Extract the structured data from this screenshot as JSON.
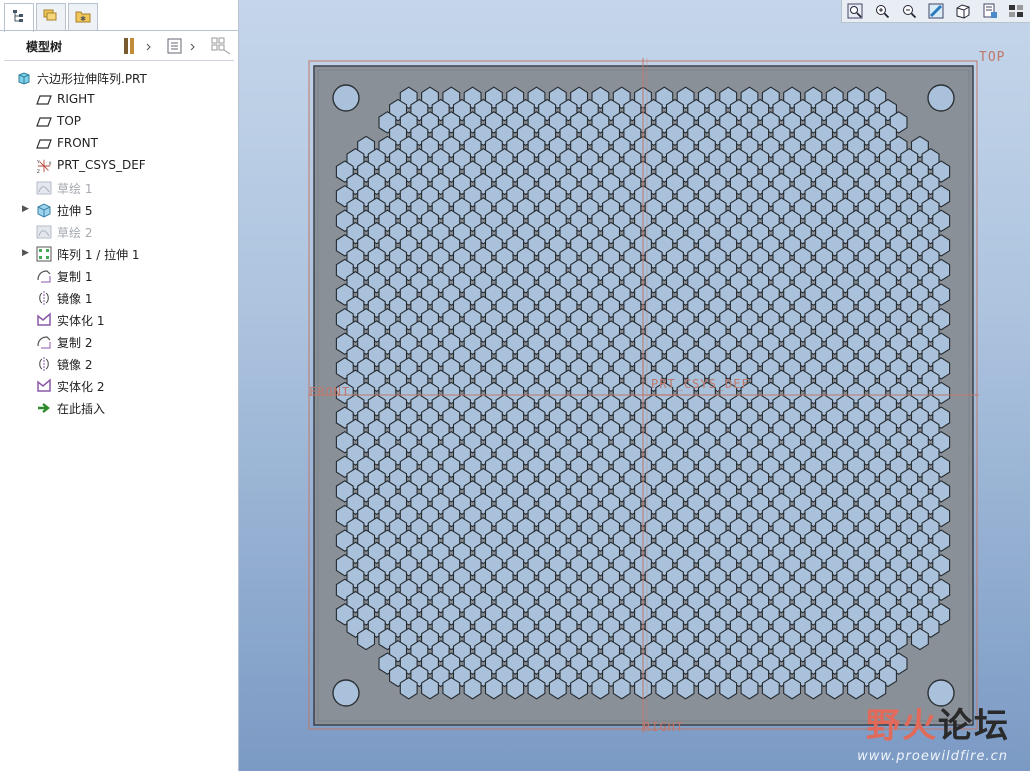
{
  "tree_title": "模型树",
  "tabs": [
    "model-tree-icon",
    "layers-icon",
    "folder-icon"
  ],
  "toolbar_icons": [
    "tools-icon",
    "settings-list-icon",
    "show-icon"
  ],
  "tree": [
    {
      "label": "六边形拉伸阵列.PRT",
      "icon": "part-icon",
      "root": true
    },
    {
      "label": "RIGHT",
      "icon": "datum-plane-icon"
    },
    {
      "label": "TOP",
      "icon": "datum-plane-icon"
    },
    {
      "label": "FRONT",
      "icon": "datum-plane-icon"
    },
    {
      "label": "PRT_CSYS_DEF",
      "icon": "csys-icon"
    },
    {
      "label": "草绘 1",
      "icon": "sketch-icon",
      "dim": true
    },
    {
      "label": "拉伸 5",
      "icon": "extrude-icon",
      "expand": true
    },
    {
      "label": "草绘 2",
      "icon": "sketch-icon",
      "dim": true
    },
    {
      "label": "阵列 1 / 拉伸 1",
      "icon": "pattern-icon",
      "expand": true
    },
    {
      "label": "复制 1",
      "icon": "copy-icon"
    },
    {
      "label": "镜像 1",
      "icon": "mirror-icon"
    },
    {
      "label": "实体化 1",
      "icon": "solidify-icon"
    },
    {
      "label": "复制 2",
      "icon": "copy-icon"
    },
    {
      "label": "镜像 2",
      "icon": "mirror-icon"
    },
    {
      "label": "实体化 2",
      "icon": "solidify-icon"
    },
    {
      "label": "在此插入",
      "icon": "insert-arrow-icon"
    }
  ],
  "view_toolbar": [
    "refit-icon",
    "zoom-in-icon",
    "zoom-out-icon",
    "repaint-icon",
    "view-orient-icon",
    "saved-views-icon",
    "display-style-icon"
  ],
  "viewport_labels": {
    "top": "TOP",
    "front": "FRONT",
    "csys": "PRT_CSYS_DEF",
    "right": "RIGHT"
  },
  "watermark": {
    "cn_part1": "野",
    "cn_part2": "火",
    "cn_part3": "论坛",
    "url": "www.proewildfire.cn"
  },
  "colors": {
    "plate": "#8a9098",
    "holes": "#a9c1da",
    "datum": "#c0786a"
  }
}
